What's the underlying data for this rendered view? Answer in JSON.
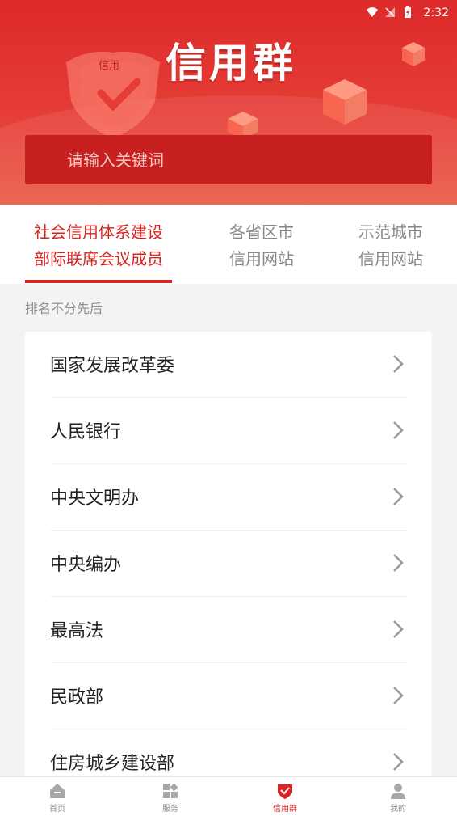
{
  "status": {
    "time": "2:32"
  },
  "hero": {
    "title": "信用群",
    "shield_text": "信用"
  },
  "search": {
    "placeholder": "请输入关键词"
  },
  "tabs": [
    {
      "line1": "社会信用体系建设",
      "line2": "部际联席会议成员",
      "active": true
    },
    {
      "line1": "各省区市",
      "line2": "信用网站",
      "active": false
    },
    {
      "line1": "示范城市",
      "line2": "信用网站",
      "active": false
    }
  ],
  "rank_note": "排名不分先后",
  "list": [
    {
      "label": "国家发展改革委"
    },
    {
      "label": "人民银行"
    },
    {
      "label": "中央文明办"
    },
    {
      "label": "中央编办"
    },
    {
      "label": "最高法"
    },
    {
      "label": "民政部"
    },
    {
      "label": "住房城乡建设部"
    }
  ],
  "nav": [
    {
      "label": "首页",
      "icon": "home-icon"
    },
    {
      "label": "服务",
      "icon": "grid-icon"
    },
    {
      "label": "信用群",
      "icon": "credit-shield-icon",
      "active": true
    },
    {
      "label": "我的",
      "icon": "user-icon"
    }
  ],
  "colors": {
    "brand_red": "#d92522",
    "hero_red": "#e53d36",
    "search_bg": "#c7201f"
  }
}
